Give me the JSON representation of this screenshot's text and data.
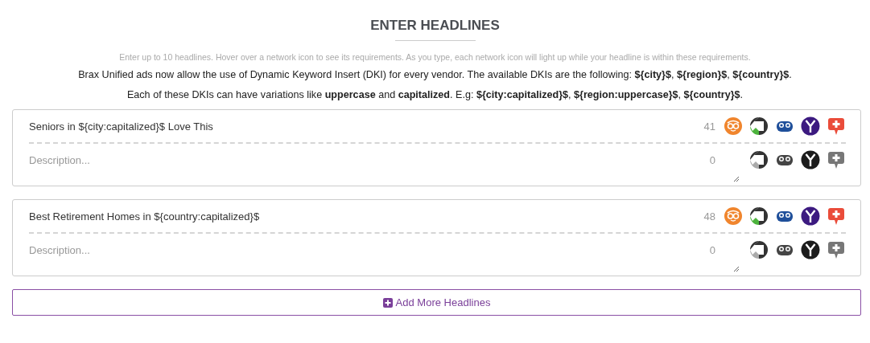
{
  "title": "ENTER HEADLINES",
  "hint": "Enter up to 10 headlines. Hover over a network icon to see its requirements. As you type, each network icon will light up while your headline is within these requirements.",
  "notes": [
    "Brax Unified ads now allow the use of Dynamic Keyword Insert (DKI) for every vendor. The available DKIs are the following: **${city}$**, **${region}$**, **${country}$**.",
    "Each of these DKIs can have variations like **uppercase** and **capitalized**. E.g: **${city:capitalized}$**, **${region:uppercase}$**, **${country}$**."
  ],
  "headlines": [
    {
      "headline": {
        "value": "Seniors in ${city:capitalized}$ Love This",
        "count": "41",
        "networks": [
          {
            "kind": "glasses",
            "active": true
          },
          {
            "kind": "arrow",
            "active": true
          },
          {
            "kind": "eyes",
            "active": true
          },
          {
            "kind": "y",
            "active": true
          },
          {
            "kind": "pin",
            "active": true
          }
        ]
      },
      "description": {
        "placeholder": "Description...",
        "count": "0",
        "networks": [
          {
            "kind": "arrow",
            "active": false
          },
          {
            "kind": "eyes",
            "active": false
          },
          {
            "kind": "y",
            "active": false
          },
          {
            "kind": "pin",
            "active": false
          }
        ]
      }
    },
    {
      "headline": {
        "value": "Best Retirement Homes in ${country:capitalized}$",
        "count": "48",
        "networks": [
          {
            "kind": "glasses",
            "active": true
          },
          {
            "kind": "arrow",
            "active": true
          },
          {
            "kind": "eyes",
            "active": true
          },
          {
            "kind": "y",
            "active": true
          },
          {
            "kind": "pin",
            "active": true
          }
        ]
      },
      "description": {
        "placeholder": "Description...",
        "count": "0",
        "networks": [
          {
            "kind": "arrow",
            "active": false
          },
          {
            "kind": "eyes",
            "active": false
          },
          {
            "kind": "y",
            "active": false
          },
          {
            "kind": "pin",
            "active": false
          }
        ]
      }
    }
  ],
  "add_button": "Add More Headlines"
}
